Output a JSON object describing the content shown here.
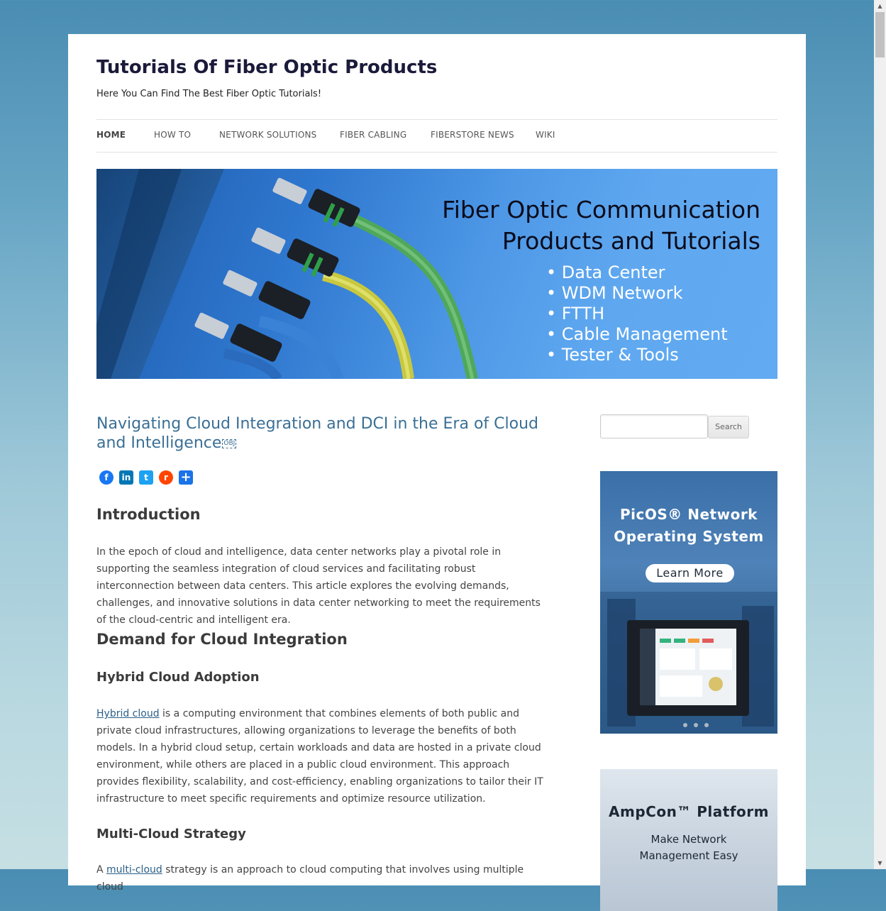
{
  "site": {
    "title": "Tutorials Of Fiber Optic Products",
    "tagline": "Here You Can Find The Best Fiber Optic Tutorials!"
  },
  "nav": {
    "items": [
      "Home",
      "How To",
      "Network Solutions",
      "Fiber Cabling",
      "Fiberstore News",
      "Wiki"
    ],
    "active": "Home"
  },
  "banner": {
    "title_line1": "Fiber Optic Communication",
    "title_line2": "Products and Tutorials",
    "list": [
      "Data Center",
      "WDM Network",
      "FTTH",
      "Cable Management",
      "Tester & Tools"
    ]
  },
  "article": {
    "title": "Navigating Cloud Integration and DCI in the Era of Cloud and Intelligence",
    "title_marker": "OBJ",
    "share_icons": [
      "facebook-icon",
      "linkedin-icon",
      "twitter-icon",
      "reddit-icon",
      "share-plus-icon"
    ],
    "h_intro": "Introduction",
    "p_intro": "In the epoch of cloud and intelligence, data center networks play a pivotal role in supporting the seamless integration of cloud services and facilitating robust interconnection between data centers. This article explores the evolving demands, challenges, and innovative solutions in data center networking to meet the requirements of the cloud-centric and intelligent era.",
    "h_demand": "Demand for Cloud Integration",
    "h_hybrid": "Hybrid Cloud Adoption",
    "hybrid_link": "Hybrid cloud",
    "p_hybrid": " is a computing environment that combines elements of both public and private cloud infrastructures, allowing organizations to leverage the benefits of both models. In a hybrid cloud setup, certain workloads and data are hosted in a private cloud environment, while others are placed in a public cloud environment. This approach provides flexibility, scalability, and cost-efficiency, enabling organizations to tailor their IT infrastructure to meet specific requirements and optimize resource utilization.",
    "h_multi": "Multi-Cloud Strategy",
    "multi_prefix": "A ",
    "multi_link": "multi-cloud",
    "p_multi": " strategy is an approach to cloud computing that involves using multiple cloud"
  },
  "sidebar": {
    "search_button": "Search",
    "search_placeholder": "",
    "ad1": {
      "title_line1": "PicOS® Network",
      "title_line2": "Operating System",
      "button": "Learn More"
    },
    "ad2": {
      "title": "AmpCon™ Platform",
      "sub_line1": "Make Network",
      "sub_line2": "Management Easy"
    }
  },
  "colors": {
    "title_link": "#3a6f95",
    "facebook": "#3b5998",
    "linkedin": "#0077b5",
    "twitter": "#1da1f2",
    "reddit": "#ff4500",
    "share": "#1a73e8"
  }
}
